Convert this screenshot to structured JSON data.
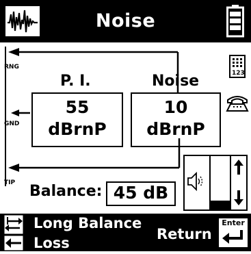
{
  "header": {
    "title": "Noise",
    "left_icon": "waveform-icon",
    "right_icon": "battery-icon"
  },
  "wiring": {
    "rng_label": "RNG",
    "gnd_label": "GND",
    "tip_label": "TIP"
  },
  "readings": {
    "pi_header": "P. I.",
    "noise_header": "Noise",
    "pi_value": "55",
    "pi_unit": "dBrnP",
    "noise_value": "10",
    "noise_unit": "dBrnP"
  },
  "balance": {
    "label": "Balance:",
    "value": "45 dB"
  },
  "side_icons": {
    "keypad_icon": "keypad-icon",
    "keypad_text": "123",
    "phone_icon": "telephone-icon"
  },
  "volume": {
    "speaker_icon": "speaker-icon",
    "up_icon": "arrow-up-icon",
    "down_icon": "arrow-down-icon",
    "level": 0.18
  },
  "footer": {
    "long_balance_label": "Long Balance",
    "loss_label": "Loss",
    "return_label": "Return",
    "enter_label": "Enter"
  },
  "colors": {
    "foreground": "#000000",
    "background": "#ffffff"
  }
}
